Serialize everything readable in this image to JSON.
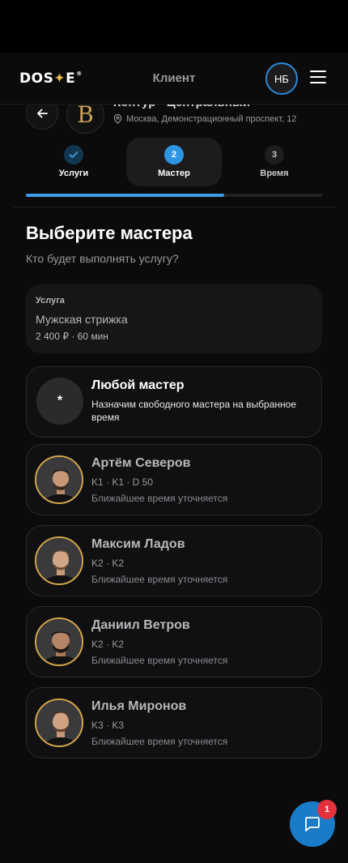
{
  "header": {
    "logo_text": "DOS",
    "logo_star": "✦",
    "logo_end": "E",
    "logo_reg": "®",
    "title": "Клиент",
    "user_initials": "НБ"
  },
  "salon": {
    "logo_letter": "B",
    "name": "Контур · Центральный",
    "address": "Москва, Демонстрационный проспект, 12"
  },
  "steps": [
    {
      "number": "✓",
      "label": "Услуги",
      "state": "done"
    },
    {
      "number": "2",
      "label": "Мастер",
      "state": "active"
    },
    {
      "number": "3",
      "label": "Время",
      "state": "pending"
    }
  ],
  "progress": {
    "fraction": 0.67
  },
  "page": {
    "title": "Выберите мастера",
    "subtitle": "Кто будет выполнять услугу?"
  },
  "service": {
    "label": "Услуга",
    "name": "Мужская стрижка",
    "meta": "2 400 ₽ · 60 мин"
  },
  "any_master": {
    "symbol": "*",
    "name": "Любой мастер",
    "description": "Назначим свободного мастера на выбранное время"
  },
  "masters": [
    {
      "name": "Артём Северов",
      "levels": "K1 · K1 · D 50",
      "time": "Ближайшее время уточняется"
    },
    {
      "name": "Максим Ладов",
      "levels": "K2 · K2",
      "time": "Ближайшее время уточняется"
    },
    {
      "name": "Даниил Ветров",
      "levels": "K2 · K2",
      "time": "Ближайшее время уточняется"
    },
    {
      "name": "Илья Миронов",
      "levels": "K3 · K3",
      "time": "Ближайшее время уточняется"
    }
  ],
  "chat": {
    "badge_count": "1",
    "icon": "chat-icon"
  },
  "colors": {
    "accent": "#3d9be8",
    "gold": "#d4a64a",
    "badge": "#e5313c"
  }
}
